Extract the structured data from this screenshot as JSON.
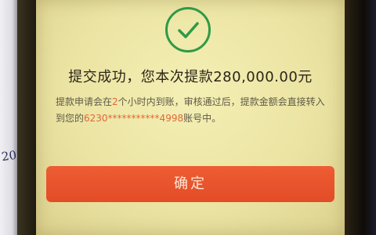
{
  "dialog": {
    "title": "提交成功，您本次提款280,000.00元",
    "message": {
      "part1": "提款申请会在",
      "hours": "2",
      "part2": "个小时内到账，审核通过后，提款金额会直接转入到您的",
      "account": "6230***********4998",
      "part3": "账号中。"
    },
    "confirm_label": "确定"
  },
  "background": {
    "paper_scribble": "20"
  },
  "colors": {
    "success_green": "#2e9a47",
    "button_orange": "#e65531",
    "highlight": "#e0683a",
    "screen_background": "#ede6a5"
  },
  "icons": {
    "success": "check-circle-icon"
  }
}
